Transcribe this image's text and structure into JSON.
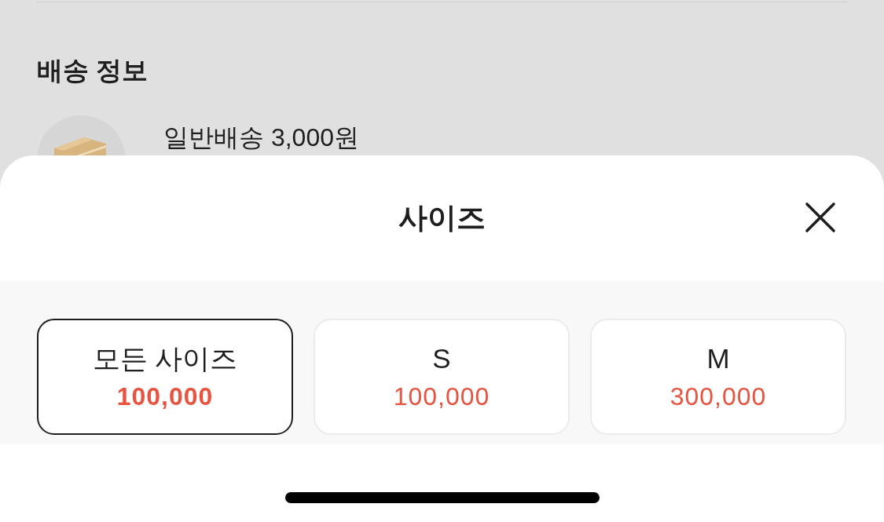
{
  "page": {
    "section_title": "배송 정보",
    "shipping": {
      "label": "일반배송 3,000원"
    }
  },
  "sheet": {
    "title": "사이즈",
    "options": [
      {
        "label": "모든 사이즈",
        "price": "100,000",
        "selected": true
      },
      {
        "label": "S",
        "price": "100,000",
        "selected": false
      },
      {
        "label": "M",
        "price": "300,000",
        "selected": false
      }
    ]
  }
}
